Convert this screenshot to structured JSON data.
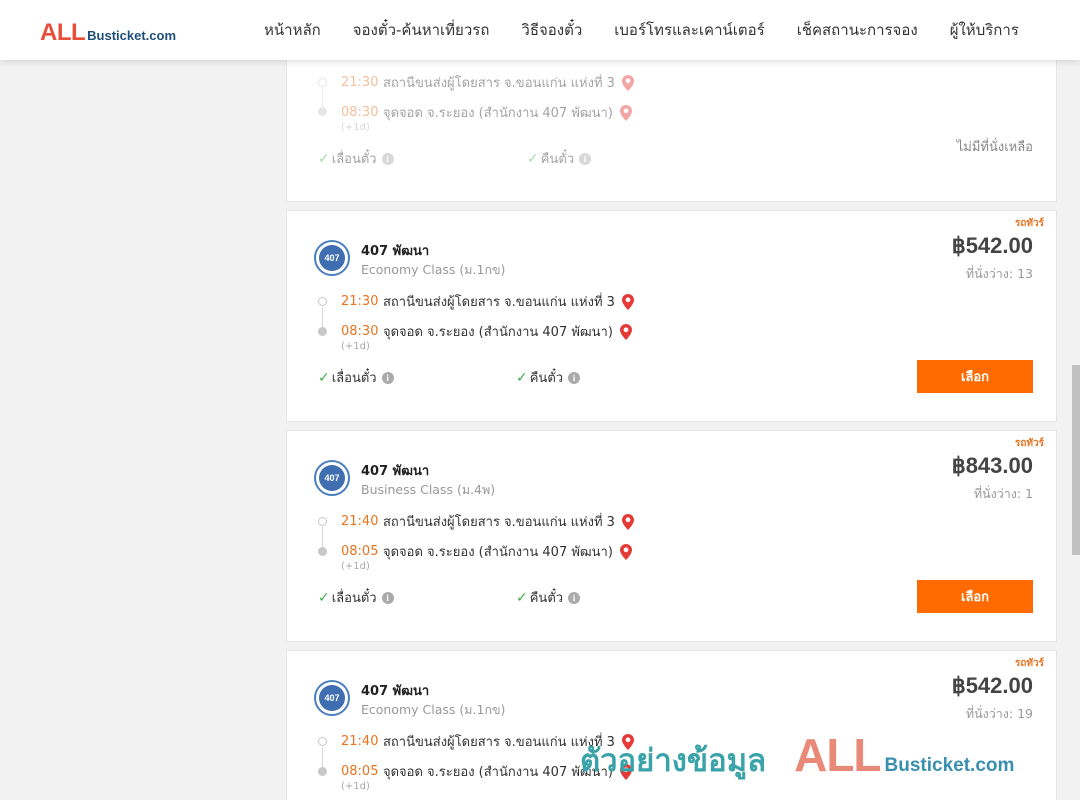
{
  "header": {
    "logo_all": "ALL",
    "logo_rest": "Busticket.com",
    "nav": [
      "หน้าหลัก",
      "จองตั๋ว-ค้นหาเที่ยวรถ",
      "วิธีจองตั๋ว",
      "เบอร์โทรและเคาน์เตอร์",
      "เช็คสถานะการจอง",
      "ผู้ให้บริการ"
    ]
  },
  "cards": [
    {
      "operator": "",
      "bus_class": "",
      "depart_time": "21:30",
      "depart_place": "สถานีขนส่งผู้โดยสาร จ.ขอนแก่น แห่งที่ 3",
      "arrive_time": "08:30",
      "arrive_place": "จุดจอด จ.ระยอง (สำนักงาน 407 พัฒนา)",
      "next_day": "(+1d)",
      "feature_change": "เลื่อนตั๋ว",
      "feature_refund": "คืนตั๋ว",
      "status": "ไม่มีที่นั่งเหลือ"
    },
    {
      "badge": "รถทัวร์",
      "operator": "407 พัฒนา",
      "logo_text": "407",
      "bus_class": "Economy Class (ม.1กข)",
      "depart_time": "21:30",
      "depart_place": "สถานีขนส่งผู้โดยสาร จ.ขอนแก่น แห่งที่ 3",
      "arrive_time": "08:30",
      "arrive_place": "จุดจอด จ.ระยอง (สำนักงาน 407 พัฒนา)",
      "next_day": "(+1d)",
      "feature_change": "เลื่อนตั๋ว",
      "feature_refund": "คืนตั๋ว",
      "price": "฿542.00",
      "seats": "ที่นั่งว่าง: 13",
      "select_label": "เลือก"
    },
    {
      "badge": "รถทัวร์",
      "operator": "407 พัฒนา",
      "logo_text": "407",
      "bus_class": "Business Class (ม.4พ)",
      "depart_time": "21:40",
      "depart_place": "สถานีขนส่งผู้โดยสาร จ.ขอนแก่น แห่งที่ 3",
      "arrive_time": "08:05",
      "arrive_place": "จุดจอด จ.ระยอง (สำนักงาน 407 พัฒนา)",
      "next_day": "(+1d)",
      "feature_change": "เลื่อนตั๋ว",
      "feature_refund": "คืนตั๋ว",
      "price": "฿843.00",
      "seats": "ที่นั่งว่าง: 1",
      "select_label": "เลือก"
    },
    {
      "badge": "รถทัวร์",
      "operator": "407 พัฒนา",
      "logo_text": "407",
      "bus_class": "Economy Class (ม.1กข)",
      "depart_time": "21:40",
      "depart_place": "สถานีขนส่งผู้โดยสาร จ.ขอนแก่น แห่งที่ 3",
      "arrive_time": "08:05",
      "arrive_place": "จุดจอด จ.ระยอง (สำนักงาน 407 พัฒนา)",
      "next_day": "(+1d)",
      "price": "฿542.00",
      "seats": "ที่นั่งว่าง: 19"
    }
  ],
  "watermark": {
    "thai": "ตัวอย่างข้อมูล",
    "all": "ALL",
    "rest": "Busticket.com"
  },
  "colors": {
    "accent_orange": "#ff6b00",
    "time_orange": "#e8731e",
    "check_green": "#3fae49",
    "pin_red": "#e53935"
  }
}
